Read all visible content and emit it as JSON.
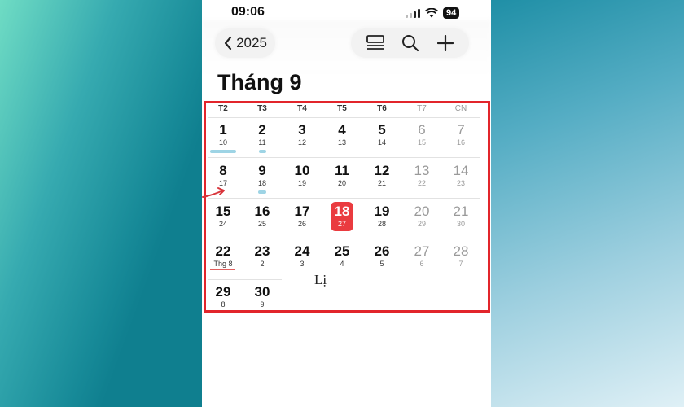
{
  "status_bar": {
    "time": "09:06",
    "battery": "94"
  },
  "header": {
    "back_label": "2025",
    "month_title": "Tháng 9"
  },
  "weekdays": [
    "T2",
    "T3",
    "T4",
    "T5",
    "T6",
    "T7",
    "CN"
  ],
  "weeks": [
    [
      {
        "day": "1",
        "lunar": "10"
      },
      {
        "day": "2",
        "lunar": "11"
      },
      {
        "day": "3",
        "lunar": "12"
      },
      {
        "day": "4",
        "lunar": "13"
      },
      {
        "day": "5",
        "lunar": "14"
      },
      {
        "day": "6",
        "lunar": "15"
      },
      {
        "day": "7",
        "lunar": "16"
      }
    ],
    [
      {
        "day": "8",
        "lunar": "17"
      },
      {
        "day": "9",
        "lunar": "18"
      },
      {
        "day": "10",
        "lunar": "19"
      },
      {
        "day": "11",
        "lunar": "20"
      },
      {
        "day": "12",
        "lunar": "21"
      },
      {
        "day": "13",
        "lunar": "22"
      },
      {
        "day": "14",
        "lunar": "23"
      }
    ],
    [
      {
        "day": "15",
        "lunar": "24"
      },
      {
        "day": "16",
        "lunar": "25"
      },
      {
        "day": "17",
        "lunar": "26"
      },
      {
        "day": "18",
        "lunar": "27"
      },
      {
        "day": "19",
        "lunar": "28"
      },
      {
        "day": "20",
        "lunar": "29"
      },
      {
        "day": "21",
        "lunar": "30"
      }
    ],
    [
      {
        "day": "22",
        "lunar": "Thg 8"
      },
      {
        "day": "23",
        "lunar": "2"
      },
      {
        "day": "24",
        "lunar": "3"
      },
      {
        "day": "25",
        "lunar": "4"
      },
      {
        "day": "26",
        "lunar": "5"
      },
      {
        "day": "27",
        "lunar": "6"
      },
      {
        "day": "28",
        "lunar": "7"
      }
    ],
    [
      {
        "day": "29",
        "lunar": "8"
      },
      {
        "day": "30",
        "lunar": "9"
      }
    ]
  ],
  "today": {
    "day": "18",
    "lunar": "27"
  },
  "watermark": "Lị",
  "colors": {
    "today_fill": "#ea3b3f",
    "highlight_border": "#e2252b",
    "event_bar": "#9ed4e5",
    "weekend_text": "#9a9a9a"
  },
  "icons": [
    "chevron-left-icon",
    "list-view-icon",
    "search-icon",
    "plus-icon",
    "wifi-icon",
    "cellular-signal-icon",
    "red-arrow-icon"
  ]
}
